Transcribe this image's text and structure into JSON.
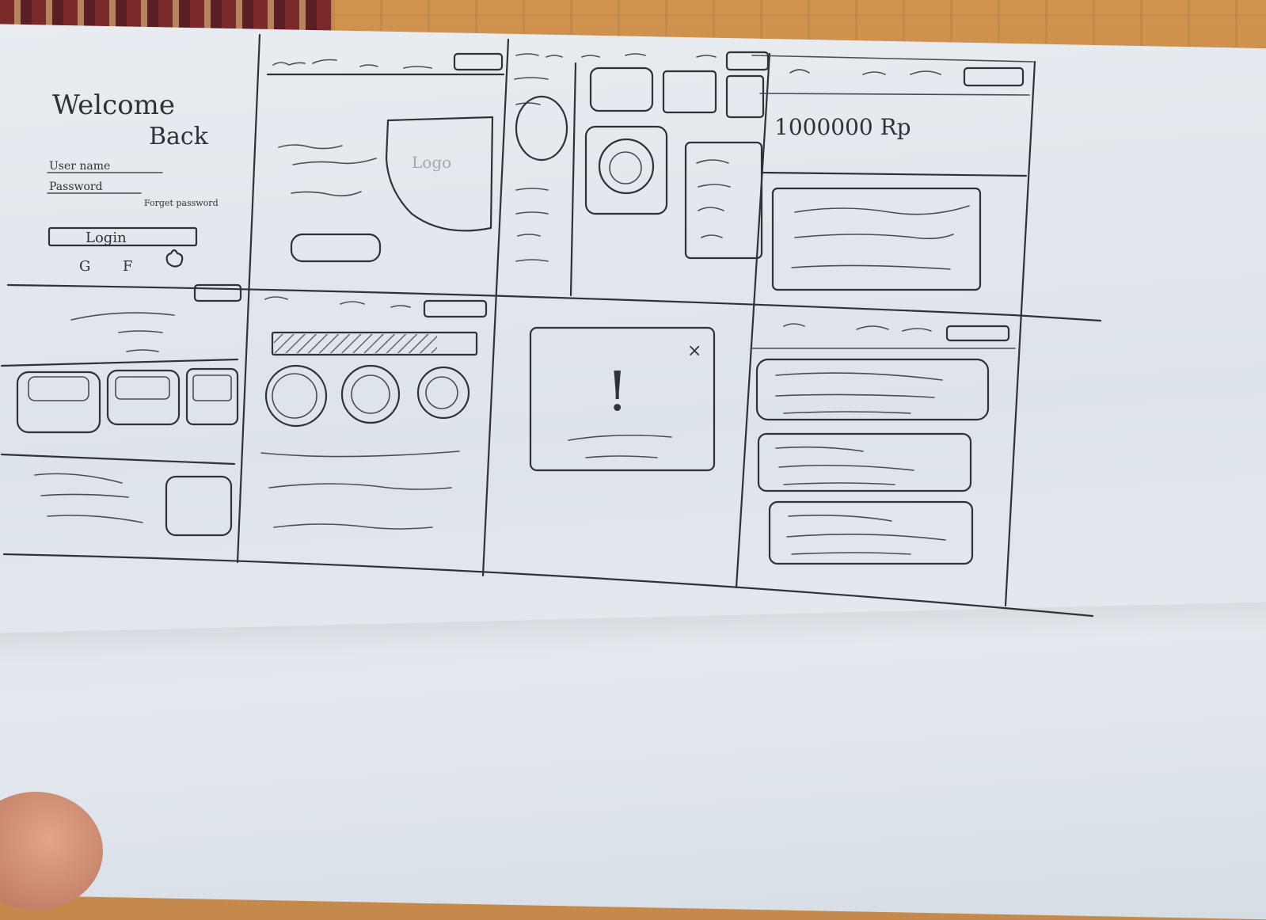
{
  "screens": {
    "login": {
      "title_line1": "Welcome",
      "title_line2": "Back",
      "username_label": "User name",
      "password_label": "Password",
      "forgot_label": "Forget password",
      "login_button": "Login",
      "social": [
        "G",
        "F",
        ""
      ]
    },
    "splash": {
      "logo_label": "Logo"
    },
    "balance": {
      "amount": "1000000 Rp"
    },
    "dialog": {
      "alert_symbol": "!",
      "close_symbol": "×"
    }
  }
}
